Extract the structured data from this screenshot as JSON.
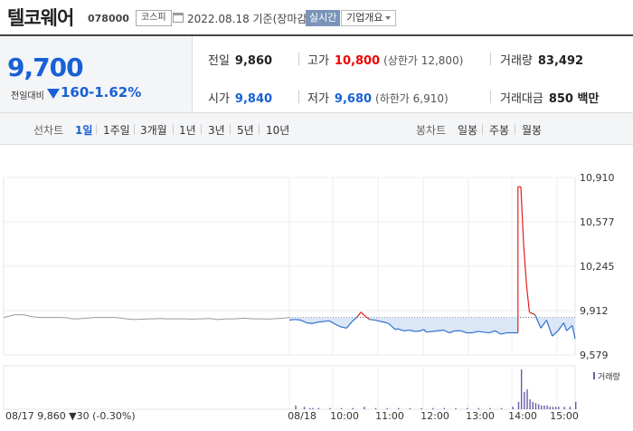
{
  "header": {
    "title": "텔코웨어",
    "code": "078000",
    "market": "코스피",
    "date": "2022.08.18 기준(장마감)",
    "realtime": "실시간",
    "overview": "기업개요"
  },
  "price_panel": {
    "price": "9,700",
    "vs_label": "전일대비",
    "change": "160",
    "rate": "-1.62%",
    "rows": [
      [
        {
          "label": "전일",
          "value": "9,860",
          "color": "dark"
        },
        {
          "label": "고가",
          "value": "10,800",
          "sub": "(상한가 12,800)",
          "color": "red"
        },
        {
          "label": "거래량",
          "value": "83,492",
          "color": "dark"
        }
      ],
      [
        {
          "label": "시가",
          "value": "9,840",
          "color": "blue"
        },
        {
          "label": "저가",
          "value": "9,680",
          "sub": "(하한가 6,910)",
          "color": "blue"
        },
        {
          "label": "거래대금",
          "value": "850 백만",
          "color": "dark"
        }
      ]
    ]
  },
  "periods": {
    "line_label": "선차트",
    "line_items": [
      "1일",
      "1주일",
      "3개월",
      "1년",
      "3년",
      "5년",
      "10년"
    ],
    "active": "1일",
    "candle_label": "봉차트",
    "candle_items": [
      "일봉",
      "주봉",
      "월봉"
    ]
  },
  "chart_data": {
    "type": "line",
    "y_ticks": [
      "10,910",
      "10,577",
      "10,245",
      "9,912",
      "9,579"
    ],
    "ylim": [
      9579,
      10910
    ],
    "reference": 9860,
    "x_labels": [
      "08/18",
      "10:00",
      "11:00",
      "12:00",
      "13:00",
      "14:00",
      "15:00"
    ],
    "volume_label": "거래량",
    "footer": "08/17  9,860 ▼30 (-0.30%)",
    "colors": {
      "prev": "#9a9a9a",
      "down": "#2f6fd0",
      "up": "#e02020",
      "fill": "#dbe6f6"
    },
    "series": [
      {
        "x": [
          0.0,
          0.02,
          0.04,
          0.07,
          0.1,
          0.13,
          0.16,
          0.19,
          0.22,
          0.24,
          0.26,
          0.29,
          0.32,
          0.35,
          0.38,
          0.4,
          0.43,
          0.46,
          0.49,
          0.52,
          0.55,
          0.57,
          0.6,
          0.63,
          0.66,
          0.69,
          0.72,
          0.75,
          0.78,
          0.81,
          0.84,
          0.87,
          0.9,
          0.93,
          0.96,
          0.98,
          1.0
        ],
        "y": [
          9860,
          9870,
          9880,
          9880,
          9865,
          9860,
          9860,
          9860,
          9858,
          9850,
          9850,
          9855,
          9860,
          9860,
          9860,
          9858,
          9850,
          9845,
          9848,
          9850,
          9852,
          9850,
          9850,
          9850,
          9848,
          9850,
          9852,
          9845,
          9850,
          9850,
          9855,
          9850,
          9850,
          9848,
          9852,
          9855,
          9860
        ]
      },
      {
        "x": [
          0.0,
          0.02,
          0.04,
          0.06,
          0.08,
          0.1,
          0.12,
          0.14,
          0.16,
          0.18,
          0.2,
          0.22,
          0.24,
          0.25,
          0.26,
          0.28,
          0.3,
          0.32,
          0.34,
          0.35,
          0.36,
          0.37,
          0.38,
          0.4,
          0.42,
          0.44,
          0.46,
          0.47,
          0.48,
          0.5,
          0.52,
          0.54,
          0.56,
          0.58,
          0.6,
          0.62,
          0.64,
          0.66,
          0.68,
          0.7,
          0.72,
          0.74,
          0.76,
          0.78,
          0.8,
          0.8,
          0.81,
          0.82,
          0.83,
          0.84,
          0.86,
          0.88,
          0.9,
          0.92,
          0.94,
          0.96,
          0.97,
          0.99,
          1.0
        ],
        "y": [
          9840,
          9845,
          9840,
          9820,
          9815,
          9825,
          9830,
          9835,
          9810,
          9790,
          9780,
          9830,
          9870,
          9900,
          9880,
          9845,
          9840,
          9830,
          9820,
          9810,
          9790,
          9770,
          9775,
          9760,
          9765,
          9755,
          9760,
          9770,
          9750,
          9755,
          9760,
          9765,
          9745,
          9760,
          9760,
          9745,
          9745,
          9755,
          9750,
          9745,
          9760,
          9735,
          9745,
          9745,
          9745,
          10840,
          10840,
          10400,
          10100,
          9900,
          9880,
          9780,
          9840,
          9720,
          9760,
          9820,
          9760,
          9800,
          9700
        ]
      }
    ],
    "volume": {
      "x": [
        0.02,
        0.05,
        0.07,
        0.08,
        0.1,
        0.14,
        0.18,
        0.22,
        0.26,
        0.3,
        0.34,
        0.38,
        0.42,
        0.46,
        0.5,
        0.54,
        0.58,
        0.62,
        0.66,
        0.7,
        0.74,
        0.78,
        0.8,
        0.81,
        0.82,
        0.83,
        0.84,
        0.85,
        0.86,
        0.87,
        0.88,
        0.89,
        0.9,
        0.91,
        0.92,
        0.93,
        0.94,
        0.96,
        0.98,
        1.0
      ],
      "v": [
        3,
        2,
        1,
        1,
        1,
        1,
        1,
        1,
        2,
        1,
        1,
        1,
        1,
        1,
        1,
        1,
        1,
        1,
        1,
        1,
        1,
        2,
        6,
        32,
        14,
        16,
        8,
        6,
        5,
        4,
        3,
        3,
        3,
        2,
        2,
        2,
        2,
        2,
        2,
        6
      ]
    }
  }
}
